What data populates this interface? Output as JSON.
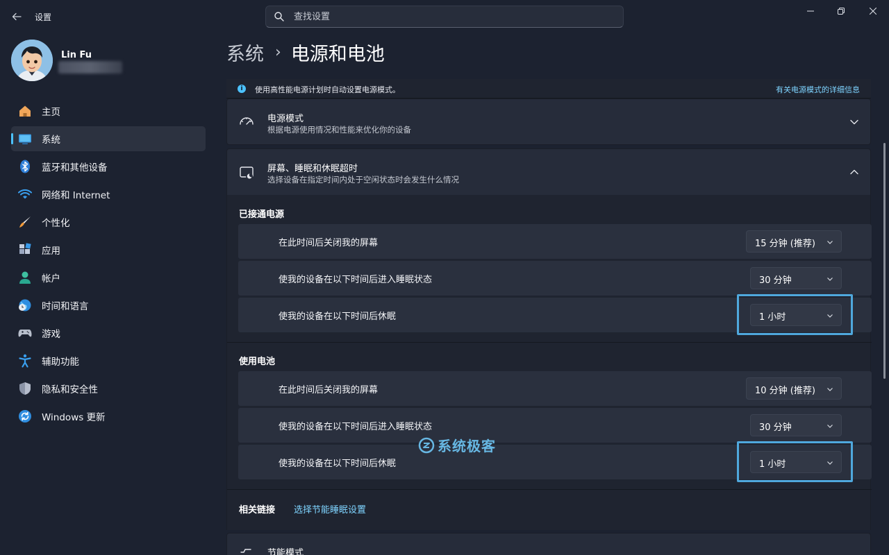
{
  "window": {
    "title": "设置"
  },
  "search": {
    "placeholder": "查找设置"
  },
  "profile": {
    "name": "Lin Fu"
  },
  "nav": {
    "items": [
      {
        "label": "主页",
        "icon": "home-icon"
      },
      {
        "label": "系统",
        "icon": "system-icon",
        "active": true
      },
      {
        "label": "蓝牙和其他设备",
        "icon": "bluetooth-icon"
      },
      {
        "label": "网络和 Internet",
        "icon": "wifi-icon"
      },
      {
        "label": "个性化",
        "icon": "brush-icon"
      },
      {
        "label": "应用",
        "icon": "apps-icon"
      },
      {
        "label": "帐户",
        "icon": "account-icon"
      },
      {
        "label": "时间和语言",
        "icon": "globe-clock-icon"
      },
      {
        "label": "游戏",
        "icon": "gamepad-icon"
      },
      {
        "label": "辅助功能",
        "icon": "accessibility-icon"
      },
      {
        "label": "隐私和安全性",
        "icon": "shield-icon"
      },
      {
        "label": "Windows 更新",
        "icon": "update-icon"
      }
    ]
  },
  "breadcrumb": {
    "parent": "系统",
    "current": "电源和电池"
  },
  "info_bar": {
    "text": "使用高性能电源计划时自动设置电源模式。",
    "link": "有关电源模式的详细信息"
  },
  "power_mode": {
    "title": "电源模式",
    "subtitle": "根据电源使用情况和性能来优化你的设备"
  },
  "screen_sleep": {
    "title": "屏幕、睡眠和休眠超时",
    "subtitle": "选择设备在指定时间内处于空闲状态时会发生什么情况",
    "plugged_in": {
      "heading": "已接通电源",
      "rows": [
        {
          "label": "在此时间后关闭我的屏幕",
          "value": "15 分钟 (推荐)"
        },
        {
          "label": "使我的设备在以下时间后进入睡眠状态",
          "value": "30 分钟"
        },
        {
          "label": "使我的设备在以下时间后休眠",
          "value": "1 小时"
        }
      ]
    },
    "on_battery": {
      "heading": "使用电池",
      "rows": [
        {
          "label": "在此时间后关闭我的屏幕",
          "value": "10 分钟 (推荐)"
        },
        {
          "label": "使我的设备在以下时间后进入睡眠状态",
          "value": "30 分钟"
        },
        {
          "label": "使我的设备在以下时间后休眠",
          "value": "1 小时"
        }
      ]
    }
  },
  "related": {
    "label": "相关链接",
    "link": "选择节能睡眠设置"
  },
  "energy_saver": {
    "title": "节能模式"
  },
  "watermark": {
    "text": "系统极客"
  },
  "colors": {
    "accent": "#4cc2ff",
    "highlight": "#4fa8dd",
    "link": "#7fd4ff"
  }
}
